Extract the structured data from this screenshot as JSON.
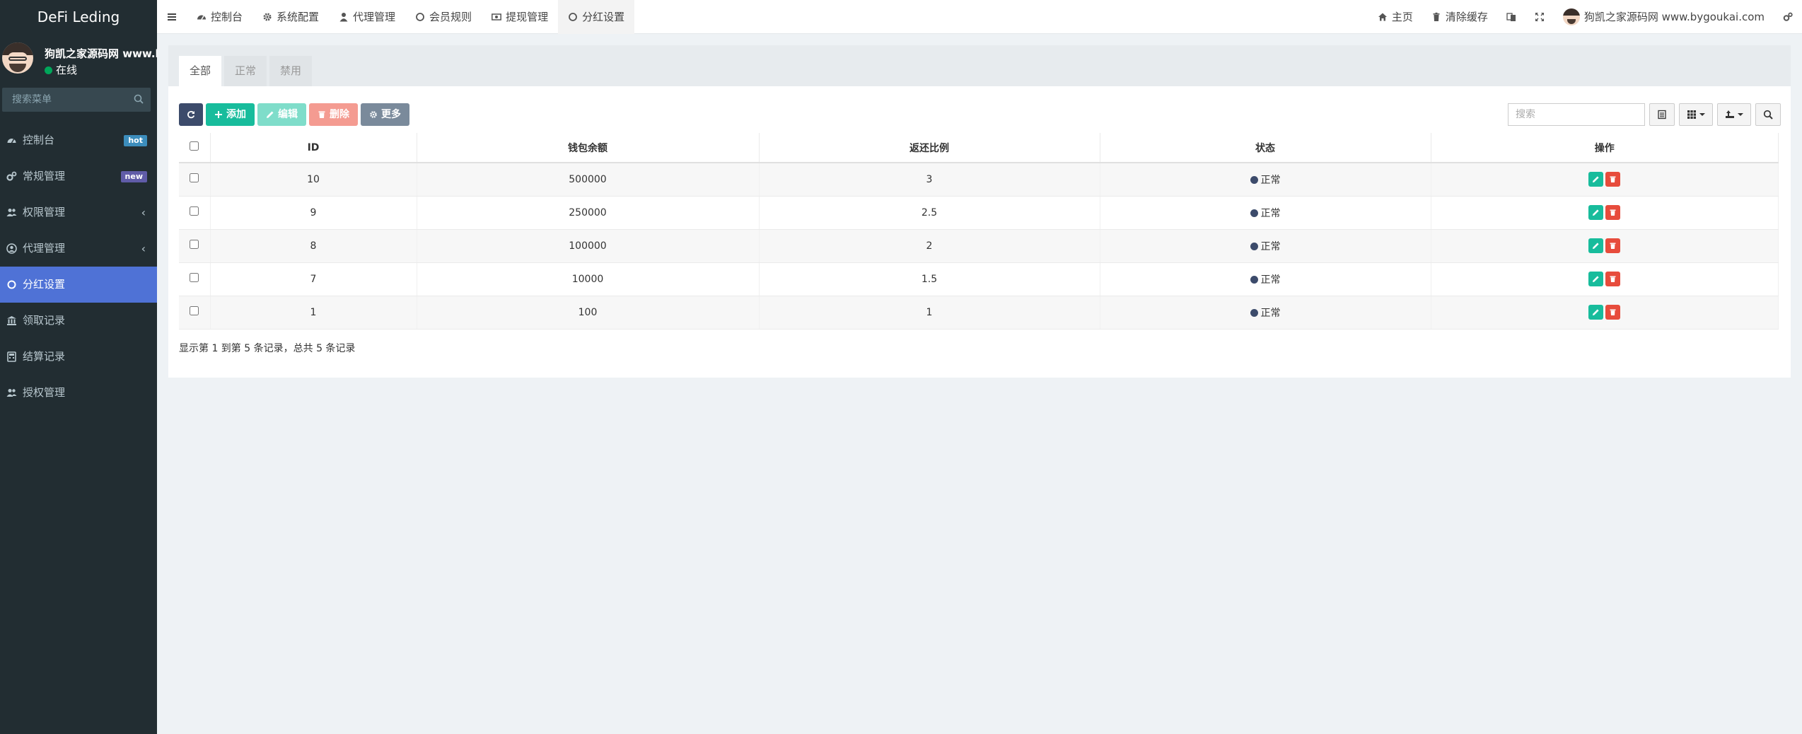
{
  "app": {
    "title": "DeFi Leding"
  },
  "user": {
    "name": "狗凯之家源码网 www.bygoukai.com",
    "status": "在线"
  },
  "sidebar": {
    "search_placeholder": "搜索菜单",
    "items": [
      {
        "label": "控制台",
        "icon": "dashboard-icon",
        "badge": "hot"
      },
      {
        "label": "常规管理",
        "icon": "cogs-icon",
        "badge": "new"
      },
      {
        "label": "权限管理",
        "icon": "users-icon",
        "chevron": "‹"
      },
      {
        "label": "代理管理",
        "icon": "user-circle-icon",
        "chevron": "‹"
      },
      {
        "label": "分红设置",
        "icon": "circle-icon",
        "active": true
      },
      {
        "label": "领取记录",
        "icon": "bank-icon"
      },
      {
        "label": "结算记录",
        "icon": "calculator-icon"
      },
      {
        "label": "授权管理",
        "icon": "users-icon"
      }
    ]
  },
  "topnav": {
    "tabs": [
      {
        "label": "控制台",
        "icon": "dashboard-icon"
      },
      {
        "label": "系统配置",
        "icon": "gear-icon"
      },
      {
        "label": "代理管理",
        "icon": "user-icon"
      },
      {
        "label": "会员规则",
        "icon": "circle-icon"
      },
      {
        "label": "提现管理",
        "icon": "money-icon"
      },
      {
        "label": "分红设置",
        "icon": "circle-icon",
        "active": true
      }
    ],
    "right": {
      "home": "主页",
      "clear_cache": "清除缓存",
      "user_name": "狗凯之家源码网 www.bygoukai.com"
    }
  },
  "filter_tabs": [
    {
      "label": "全部",
      "active": true
    },
    {
      "label": "正常"
    },
    {
      "label": "禁用"
    }
  ],
  "toolbar": {
    "add": "添加",
    "edit": "编辑",
    "delete": "删除",
    "more": "更多",
    "search_placeholder": "搜索"
  },
  "table": {
    "headers": [
      "ID",
      "钱包余额",
      "返还比例",
      "状态",
      "操作"
    ],
    "rows": [
      {
        "id": "10",
        "balance": "500000",
        "ratio": "3",
        "status": "正常"
      },
      {
        "id": "9",
        "balance": "250000",
        "ratio": "2.5",
        "status": "正常"
      },
      {
        "id": "8",
        "balance": "100000",
        "ratio": "2",
        "status": "正常"
      },
      {
        "id": "7",
        "balance": "10000",
        "ratio": "1.5",
        "status": "正常"
      },
      {
        "id": "1",
        "balance": "100",
        "ratio": "1",
        "status": "正常"
      }
    ]
  },
  "pagination": {
    "summary": "显示第 1 到第 5 条记录，总共 5 条记录"
  },
  "colors": {
    "sidebar_bg": "#222d32",
    "active_menu": "#4f72d6",
    "success": "#18bc9c",
    "danger": "#e74c3c"
  }
}
